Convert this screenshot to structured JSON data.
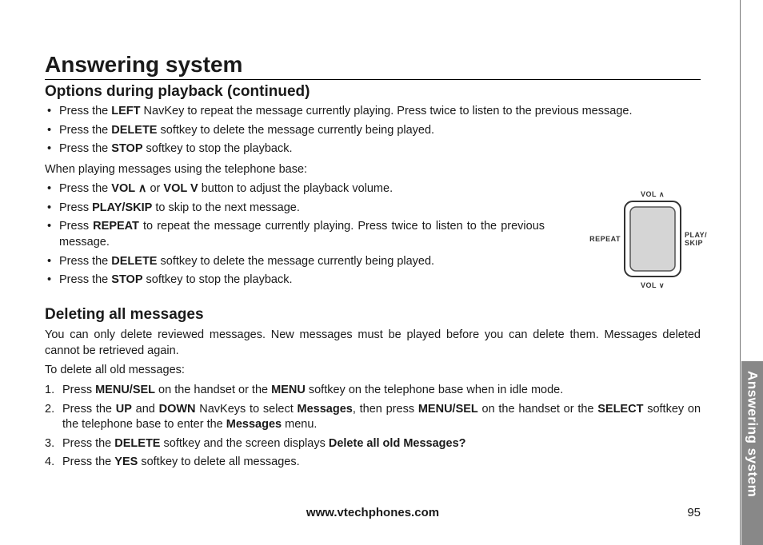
{
  "heading": "Answering system",
  "section1_title": "Options during playback (continued)",
  "opts1": [
    {
      "pre": "Press the ",
      "key": "LEFT",
      "post": " NavKey to repeat the message currently playing. Press twice to listen to the previous message."
    },
    {
      "pre": "Press the ",
      "key": "DELETE",
      "post": " softkey to delete the message currently being played."
    },
    {
      "pre": "Press the ",
      "key": "STOP",
      "post": " softkey to stop the playback."
    }
  ],
  "base_intro": "When playing messages using the telephone base:",
  "opts2": [
    {
      "parts": [
        "Press the ",
        {
          "b": "VOL ∧"
        },
        " or ",
        {
          "b": "VOL V"
        },
        " button to adjust the playback volume."
      ]
    },
    {
      "parts": [
        "Press ",
        {
          "b": "PLAY/SKIP"
        },
        " to skip to the next message."
      ]
    },
    {
      "parts": [
        "Press ",
        {
          "b": "REPEAT"
        },
        " to repeat the message currently playing. Press twice to listen to the previous message."
      ]
    },
    {
      "parts": [
        "Press the ",
        {
          "b": "DELETE"
        },
        " softkey to delete the message currently being played."
      ]
    },
    {
      "parts": [
        "Press the ",
        {
          "b": "STOP"
        },
        " softkey to stop the playback."
      ]
    }
  ],
  "section2_title": "Deleting all messages",
  "delete_intro": "You can only delete reviewed messages. New messages must be played before you can delete them. Messages deleted cannot be retrieved again.",
  "delete_lead": "To delete all old messages:",
  "steps": [
    {
      "parts": [
        "Press ",
        {
          "b": "MENU/SEL"
        },
        " on the handset or the ",
        {
          "b": "MENU"
        },
        " softkey on the telephone base when in idle mode."
      ]
    },
    {
      "parts": [
        "Press the ",
        {
          "b": "UP"
        },
        " and ",
        {
          "b": "DOWN"
        },
        " NavKeys to select ",
        {
          "b": "Messages"
        },
        ", then press ",
        {
          "b": "MENU/SEL"
        },
        " on the handset or the ",
        {
          "b": "SELECT"
        },
        " softkey on the telephone base to enter the ",
        {
          "b": "Messages"
        },
        " menu."
      ]
    },
    {
      "parts": [
        "Press the ",
        {
          "b": "DELETE"
        },
        " softkey and the screen displays ",
        {
          "b": "Delete all old Messages?"
        }
      ]
    },
    {
      "parts": [
        "Press the ",
        {
          "b": "YES"
        },
        " softkey to delete all messages."
      ]
    }
  ],
  "diagram": {
    "top": "VOL ∧",
    "right1": "PLAY/",
    "right2": "SKIP",
    "left": "REPEAT",
    "bottom": "VOL ∨"
  },
  "footer_url": "www.vtechphones.com",
  "page_number": "95",
  "side_tab": "Answering system"
}
